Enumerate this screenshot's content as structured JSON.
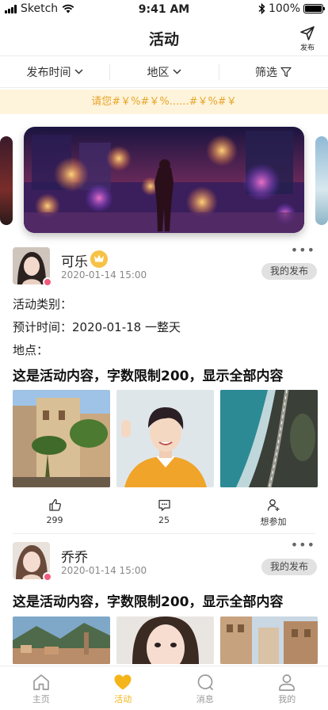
{
  "status_bar": {
    "carrier": "Sketch",
    "time": "9:41 AM",
    "battery": "100%",
    "battery_level": 1.0
  },
  "header": {
    "title": "活动",
    "publish_label": "发布"
  },
  "filters": [
    {
      "label": "发布时间",
      "icon": "chevron-down-icon"
    },
    {
      "label": "地区",
      "icon": "chevron-down-icon"
    },
    {
      "label": "筛选",
      "icon": "filter-icon"
    }
  ],
  "notice": "请您#￥%#￥%......#￥%#￥",
  "posts": [
    {
      "user": "可乐",
      "badge": "crown-icon",
      "date": "2020-01-14  15:00",
      "tag": "我的发布",
      "category_label": "活动类别：",
      "time_label": "预计时间：",
      "time_value": "2020-01-18 一整天",
      "place_label": "地点：",
      "content": "这是活动内容，字数限制200，显示全部内容",
      "likes": "299",
      "comments": "25",
      "join_label": "想参加"
    },
    {
      "user": "乔乔",
      "date": "2020-01-14  15:00",
      "tag": "我的发布",
      "content": "这是活动内容，字数限制200，显示全部内容"
    }
  ],
  "tabbar": [
    {
      "label": "主页",
      "icon": "home-icon",
      "active": false
    },
    {
      "label": "活动",
      "icon": "heart-icon",
      "active": true
    },
    {
      "label": "消息",
      "icon": "message-icon",
      "active": false
    },
    {
      "label": "我的",
      "icon": "profile-icon",
      "active": false
    }
  ],
  "colors": {
    "accent": "#f3b51a",
    "notice_bg": "#fef4dc",
    "notice_text": "#e7a52b",
    "tag_bg": "#e1e1e1"
  }
}
